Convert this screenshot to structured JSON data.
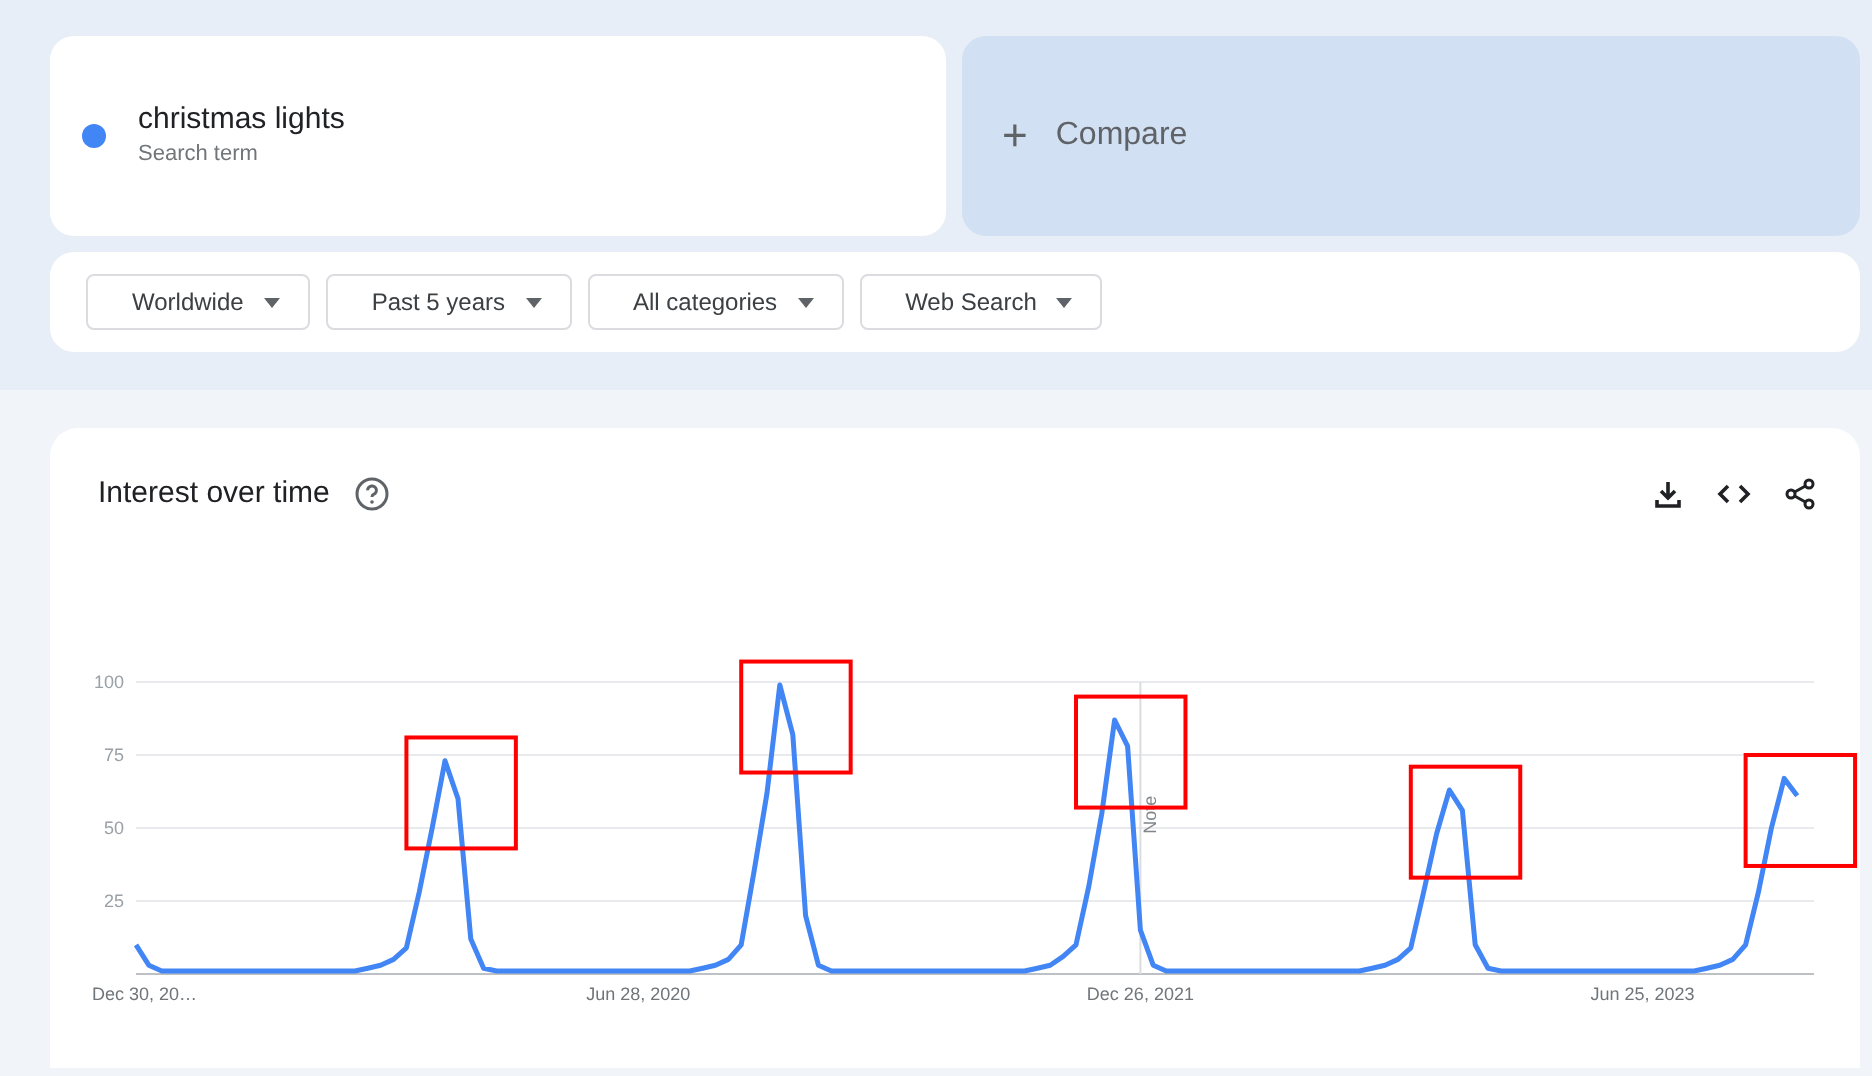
{
  "search_term": {
    "color": "#4285f4",
    "label": "christmas lights",
    "sublabel": "Search term"
  },
  "compare": {
    "icon": "+",
    "label": "Compare"
  },
  "filters": [
    {
      "label": "Worldwide"
    },
    {
      "label": "Past 5 years"
    },
    {
      "label": "All categories"
    },
    {
      "label": "Web Search"
    }
  ],
  "interest_over_time": {
    "title": "Interest over time",
    "chart_data": {
      "type": "line",
      "categories": [
        "Dec 30, 20…",
        null,
        null,
        null,
        null,
        null,
        null,
        null,
        null,
        null,
        null,
        null,
        null,
        null,
        null,
        null,
        null,
        null,
        null,
        null,
        null,
        null,
        null,
        null,
        null,
        null,
        null,
        null,
        null,
        null,
        null,
        null,
        null,
        null,
        null,
        null,
        null,
        null,
        null,
        "Jun 28, 2020",
        null,
        null,
        null,
        null,
        null,
        null,
        null,
        null,
        null,
        null,
        null,
        null,
        null,
        null,
        null,
        null,
        null,
        null,
        null,
        null,
        null,
        null,
        null,
        null,
        null,
        null,
        null,
        null,
        null,
        null,
        null,
        null,
        null,
        null,
        null,
        null,
        null,
        null,
        "Dec 26, 2021",
        null,
        null,
        null,
        null,
        null,
        null,
        null,
        null,
        null,
        null,
        null,
        null,
        null,
        null,
        null,
        null,
        null,
        null,
        null,
        null,
        null,
        null,
        null,
        null,
        null,
        null,
        null,
        null,
        null,
        null,
        null,
        null,
        null,
        null,
        null,
        null,
        null,
        null,
        "Jun 25, 2023",
        null,
        null,
        null,
        null,
        null,
        null,
        null,
        null,
        null,
        null,
        null,
        null
      ],
      "series": [
        {
          "color": "#4285f4",
          "values": [
            10,
            3,
            1,
            1,
            1,
            1,
            1,
            1,
            1,
            1,
            1,
            1,
            1,
            1,
            1,
            1,
            1,
            1,
            2,
            3,
            5,
            9,
            28,
            50,
            73,
            60,
            12,
            2,
            1,
            1,
            1,
            1,
            1,
            1,
            1,
            1,
            1,
            1,
            1,
            1,
            1,
            1,
            1,
            1,
            2,
            3,
            5,
            10,
            35,
            62,
            99,
            82,
            20,
            3,
            1,
            1,
            1,
            1,
            1,
            1,
            1,
            1,
            1,
            1,
            1,
            1,
            1,
            1,
            1,
            1,
            2,
            3,
            6,
            10,
            30,
            55,
            87,
            78,
            15,
            3,
            1,
            1,
            1,
            1,
            1,
            1,
            1,
            1,
            1,
            1,
            1,
            1,
            1,
            1,
            1,
            1,
            2,
            3,
            5,
            9,
            28,
            48,
            63,
            56,
            10,
            2,
            1,
            1,
            1,
            1,
            1,
            1,
            1,
            1,
            1,
            1,
            1,
            1,
            1,
            1,
            1,
            1,
            2,
            3,
            5,
            10,
            28,
            50,
            67,
            61
          ]
        }
      ],
      "ylim": [
        0,
        100
      ],
      "yticks": [
        25,
        50,
        75,
        100
      ],
      "grid": true,
      "annotations": [
        {
          "text": "Note",
          "x": "Dec 26, 2021"
        }
      ]
    }
  }
}
